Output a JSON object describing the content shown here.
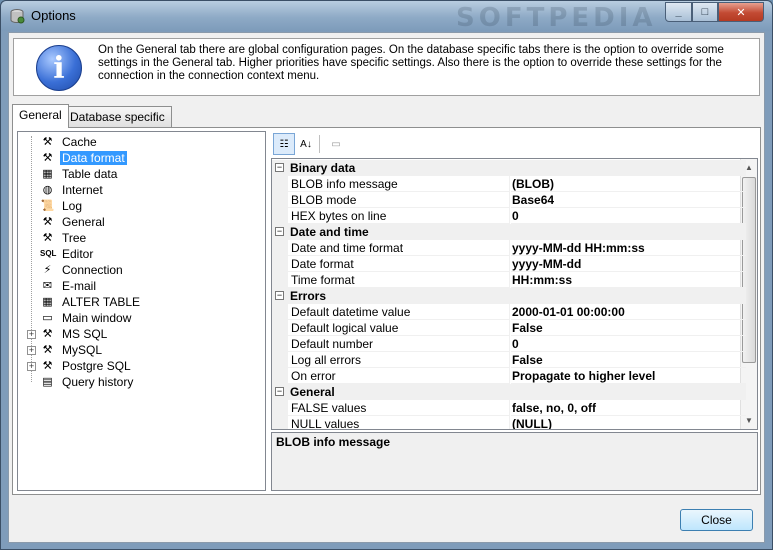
{
  "window": {
    "title": "Options",
    "watermark": "SOFTPEDIA",
    "min": "_",
    "max": "□",
    "close": "✕"
  },
  "info": {
    "icon": "info-icon",
    "text": "On the General tab there are global configuration pages. On the database specific tabs there is the option to override some settings in the General tab. Higher priorities have specific settings. Also there is the option to override these settings for the connection in the connection context menu."
  },
  "tabs": [
    {
      "label": "General",
      "active": true
    },
    {
      "label": "Database specific",
      "active": false
    }
  ],
  "tree": {
    "items": [
      {
        "label": "Cache",
        "icon": "tools-icon",
        "glyph": "⚒"
      },
      {
        "label": "Data format",
        "icon": "tools-icon",
        "glyph": "⚒",
        "selected": true
      },
      {
        "label": "Table data",
        "icon": "table-icon",
        "glyph": "▦"
      },
      {
        "label": "Internet",
        "icon": "globe-icon",
        "glyph": "◍"
      },
      {
        "label": "Log",
        "icon": "log-icon",
        "glyph": "📜"
      },
      {
        "label": "General",
        "icon": "tools-icon",
        "glyph": "⚒"
      },
      {
        "label": "Tree",
        "icon": "tools-icon",
        "glyph": "⚒"
      },
      {
        "label": "Editor",
        "icon": "sql-editor-icon",
        "glyph": "SQL"
      },
      {
        "label": "Connection",
        "icon": "connection-icon",
        "glyph": "⚡"
      },
      {
        "label": "E-mail",
        "icon": "email-icon",
        "glyph": "✉"
      },
      {
        "label": "ALTER TABLE",
        "icon": "alter-table-icon",
        "glyph": "▦"
      },
      {
        "label": "Main window",
        "icon": "window-icon",
        "glyph": "▭"
      },
      {
        "label": "MS SQL",
        "icon": "tools-icon",
        "glyph": "⚒",
        "expandable": true
      },
      {
        "label": "MySQL",
        "icon": "tools-icon",
        "glyph": "⚒",
        "expandable": true
      },
      {
        "label": "Postgre SQL",
        "icon": "tools-icon",
        "glyph": "⚒",
        "expandable": true
      },
      {
        "label": "Query history",
        "icon": "history-icon",
        "glyph": "▤"
      }
    ]
  },
  "toolbar": {
    "categorized": "☷",
    "alphabetical": "A↓",
    "property_pages": "▭"
  },
  "grid": {
    "categories": [
      {
        "name": "Binary data",
        "rows": [
          {
            "name": "BLOB info message",
            "value": "(BLOB)"
          },
          {
            "name": "BLOB mode",
            "value": "Base64"
          },
          {
            "name": "HEX bytes on line",
            "value": "0"
          }
        ]
      },
      {
        "name": "Date and time",
        "rows": [
          {
            "name": "Date and time format",
            "value": "yyyy-MM-dd HH:mm:ss"
          },
          {
            "name": "Date format",
            "value": "yyyy-MM-dd"
          },
          {
            "name": "Time format",
            "value": "HH:mm:ss"
          }
        ]
      },
      {
        "name": "Errors",
        "rows": [
          {
            "name": "Default datetime value",
            "value": "2000-01-01 00:00:00"
          },
          {
            "name": "Default logical value",
            "value": "False"
          },
          {
            "name": "Default number",
            "value": "0"
          },
          {
            "name": "Log all errors",
            "value": "False"
          },
          {
            "name": "On error",
            "value": "Propagate to higher level"
          }
        ]
      },
      {
        "name": "General",
        "rows": [
          {
            "name": "FALSE values",
            "value": "false, no, 0, off"
          },
          {
            "name": "NULL values",
            "value": "(NULL)"
          }
        ]
      }
    ]
  },
  "description": {
    "title": "BLOB info message"
  },
  "footer": {
    "close_label": "Close"
  }
}
